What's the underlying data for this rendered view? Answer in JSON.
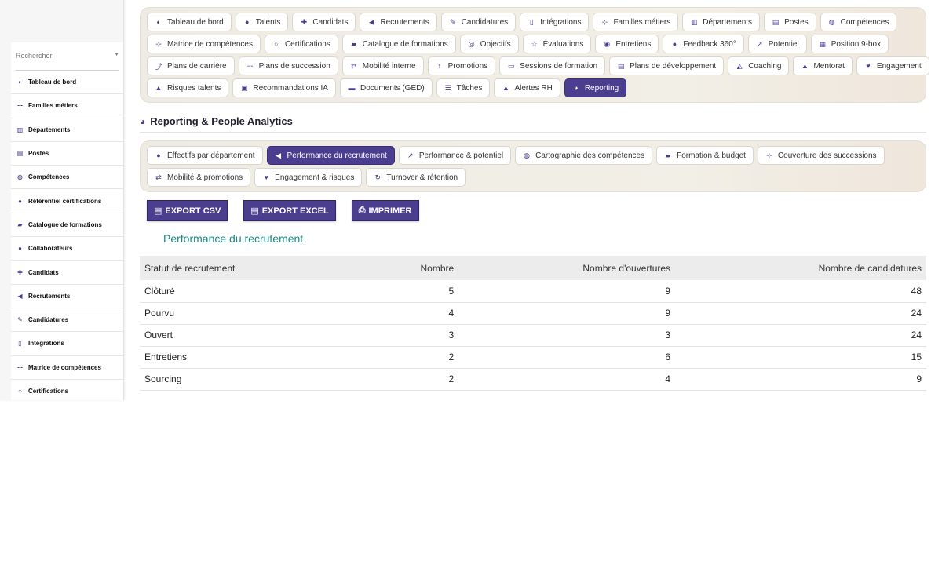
{
  "sidebar": {
    "search_placeholder": "Rechercher",
    "items": [
      {
        "label": "Tableau de bord",
        "icon": "dashboard-icon",
        "glyph": "◐"
      },
      {
        "label": "Familles métiers",
        "icon": "sitemap-icon",
        "glyph": "⊹"
      },
      {
        "label": "Départements",
        "icon": "building-icon",
        "glyph": "▥"
      },
      {
        "label": "Postes",
        "icon": "id-card-icon",
        "glyph": "▤"
      },
      {
        "label": "Compétences",
        "icon": "brain-icon",
        "glyph": "◍"
      },
      {
        "label": "Référentiel certifications",
        "icon": "certificate-icon",
        "glyph": "●"
      },
      {
        "label": "Catalogue de formations",
        "icon": "graduation-cap-icon",
        "glyph": "▰"
      },
      {
        "label": "Collaborateurs",
        "icon": "user-icon",
        "glyph": "●"
      },
      {
        "label": "Candidats",
        "icon": "user-plus-icon",
        "glyph": "✚"
      },
      {
        "label": "Recrutements",
        "icon": "megaphone-icon",
        "glyph": "◀"
      },
      {
        "label": "Candidatures",
        "icon": "file-signature-icon",
        "glyph": "✎"
      },
      {
        "label": "Intégrations",
        "icon": "door-icon",
        "glyph": "▯"
      },
      {
        "label": "Matrice de compétences",
        "icon": "sitemap-icon",
        "glyph": "⊹"
      },
      {
        "label": "Certifications",
        "icon": "award-icon",
        "glyph": "○"
      }
    ]
  },
  "tabs": {
    "rows": [
      [
        {
          "label": "Tableau de bord",
          "icon": "dashboard-icon",
          "glyph": "◐"
        },
        {
          "label": "Talents",
          "icon": "user-icon",
          "glyph": "●"
        },
        {
          "label": "Candidats",
          "icon": "user-plus-icon",
          "glyph": "✚"
        },
        {
          "label": "Recrutements",
          "icon": "megaphone-icon",
          "glyph": "◀"
        },
        {
          "label": "Candidatures",
          "icon": "file-signature-icon",
          "glyph": "✎"
        },
        {
          "label": "Intégrations",
          "icon": "door-icon",
          "glyph": "▯"
        },
        {
          "label": "Familles métiers",
          "icon": "sitemap-icon",
          "glyph": "⊹"
        },
        {
          "label": "Départements",
          "icon": "building-icon",
          "glyph": "▥"
        },
        {
          "label": "Postes",
          "icon": "id-card-icon",
          "glyph": "▤"
        },
        {
          "label": "Compétences",
          "icon": "brain-icon",
          "glyph": "◍"
        }
      ],
      [
        {
          "label": "Matrice de compétences",
          "icon": "sitemap-icon",
          "glyph": "⊹"
        },
        {
          "label": "Certifications",
          "icon": "award-icon",
          "glyph": "○"
        },
        {
          "label": "Catalogue de formations",
          "icon": "graduation-cap-icon",
          "glyph": "▰"
        },
        {
          "label": "Objectifs",
          "icon": "bullseye-icon",
          "glyph": "◎"
        },
        {
          "label": "Évaluations",
          "icon": "star-half-icon",
          "glyph": "☆"
        },
        {
          "label": "Entretiens",
          "icon": "comments-icon",
          "glyph": "◉"
        },
        {
          "label": "Feedback 360°",
          "icon": "comment-dots-icon",
          "glyph": "●"
        },
        {
          "label": "Potentiel",
          "icon": "chart-line-icon",
          "glyph": "↗"
        },
        {
          "label": "Position 9-box",
          "icon": "grid-icon",
          "glyph": "▦"
        }
      ],
      [
        {
          "label": "Plans de carrière",
          "icon": "route-icon",
          "glyph": "⤴"
        },
        {
          "label": "Plans de succession",
          "icon": "sitemap-icon",
          "glyph": "⊹"
        },
        {
          "label": "Mobilité interne",
          "icon": "exchange-icon",
          "glyph": "⇄"
        },
        {
          "label": "Promotions",
          "icon": "arrow-up-icon",
          "glyph": "↑"
        },
        {
          "label": "Sessions de formation",
          "icon": "chalkboard-icon",
          "glyph": "▭"
        },
        {
          "label": "Plans de développement",
          "icon": "clipboard-icon",
          "glyph": "▤"
        },
        {
          "label": "Coaching",
          "icon": "handshake-icon",
          "glyph": "◭"
        },
        {
          "label": "Mentorat",
          "icon": "user-tie-icon",
          "glyph": "▲"
        },
        {
          "label": "Engagement",
          "icon": "heart-icon",
          "glyph": "♥"
        }
      ],
      [
        {
          "label": "Risques talents",
          "icon": "warning-icon",
          "glyph": "▲"
        },
        {
          "label": "Recommandations IA",
          "icon": "robot-icon",
          "glyph": "▣"
        },
        {
          "label": "Documents (GED)",
          "icon": "folder-open-icon",
          "glyph": "▬"
        },
        {
          "label": "Tâches",
          "icon": "list-check-icon",
          "glyph": "☰"
        },
        {
          "label": "Alertes RH",
          "icon": "bell-icon",
          "glyph": "▲"
        },
        {
          "label": "Reporting",
          "icon": "chart-pie-icon",
          "glyph": "◕",
          "active": true
        }
      ]
    ]
  },
  "section": {
    "title": "Reporting & People Analytics",
    "icon": "chart-pie-icon",
    "glyph": "◕"
  },
  "subtabs": {
    "rows": [
      [
        {
          "label": "Effectifs par département",
          "icon": "users-icon",
          "glyph": "●"
        },
        {
          "label": "Performance du recrutement",
          "icon": "megaphone-icon",
          "glyph": "◀",
          "active": true
        },
        {
          "label": "Performance & potentiel",
          "icon": "chart-line-icon",
          "glyph": "↗"
        },
        {
          "label": "Cartographie des compétences",
          "icon": "brain-icon",
          "glyph": "◍"
        },
        {
          "label": "Formation & budget",
          "icon": "graduation-cap-icon",
          "glyph": "▰"
        },
        {
          "label": "Couverture des successions",
          "icon": "sitemap-icon",
          "glyph": "⊹"
        }
      ],
      [
        {
          "label": "Mobilité & promotions",
          "icon": "exchange-icon",
          "glyph": "⇄"
        },
        {
          "label": "Engagement & risques",
          "icon": "heart-icon",
          "glyph": "♥"
        },
        {
          "label": "Turnover & rétention",
          "icon": "sync-icon",
          "glyph": "↻"
        }
      ]
    ]
  },
  "actions": [
    {
      "label": "EXPORT CSV",
      "icon": "file-csv-icon",
      "glyph": "▤"
    },
    {
      "label": "EXPORT EXCEL",
      "icon": "file-excel-icon",
      "glyph": "▤"
    },
    {
      "label": "IMPRIMER",
      "icon": "print-icon",
      "glyph": "⎙"
    }
  ],
  "report": {
    "title": "Performance du recrutement",
    "columns": [
      "Statut de recrutement",
      "Nombre",
      "Nombre d'ouvertures",
      "Nombre de candidatures"
    ],
    "rows": [
      [
        "Clôturé",
        "5",
        "9",
        "48"
      ],
      [
        "Pourvu",
        "4",
        "9",
        "24"
      ],
      [
        "Ouvert",
        "3",
        "3",
        "24"
      ],
      [
        "Entretiens",
        "2",
        "6",
        "15"
      ],
      [
        "Sourcing",
        "2",
        "4",
        "9"
      ]
    ]
  },
  "colors": {
    "accent": "#4b3e8e",
    "report_title": "#1a8a86"
  }
}
